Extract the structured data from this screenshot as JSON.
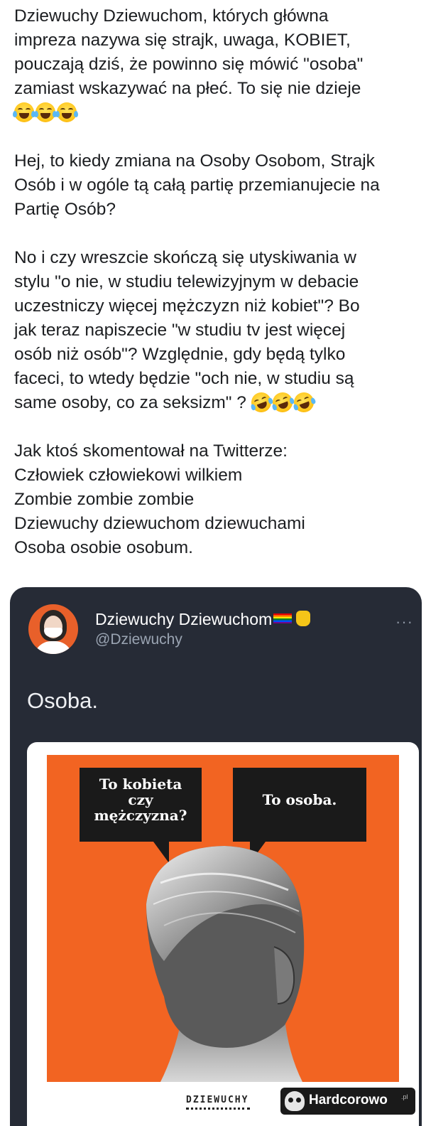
{
  "post": {
    "paragraphs": [
      {
        "lines": [
          "Dziewuchy Dziewuchom, których główna",
          "impreza nazywa się strajk, uwaga, KOBIET,",
          "pouczają dziś, że powinno się mówić \"osoba\"",
          "zamiast wskazywać na płeć. To się nie dzieje"
        ],
        "emoji": "😂😂😂"
      },
      {
        "lines": [
          "Hej, to kiedy zmiana na Osoby Osobom, Strajk",
          "Osób i w ogóle tą całą partię przemianujecie na",
          "Partię Osób?"
        ]
      },
      {
        "lines": [
          "No i czy wreszcie skończą się utyskiwania w",
          "stylu \"o nie, w studiu telewizyjnym w debacie",
          "uczestniczy więcej mężczyzn niż kobiet\"? Bo",
          "jak teraz napiszecie \"w studiu tv jest więcej",
          "osób niż osób\"? Względnie, gdy będą tylko",
          "faceci, to wtedy będzie \"och nie, w studiu są",
          "same osoby, co za seksizm\" ?"
        ],
        "emoji": "🤣🤣🤣"
      },
      {
        "lines": [
          "Jak ktoś skomentował na Twitterze:",
          "Człowiek człowiekowi wilkiem",
          "Zombie zombie zombie",
          "Dziewuchy dziewuchom dziewuchami",
          "Osoba osobie osobum."
        ]
      }
    ]
  },
  "tweet": {
    "author_name": "Dziewuchy Dziewuchom",
    "author_icons": [
      "rainbow-flag-icon",
      "raised-fist-icon"
    ],
    "handle": "@Dziewuchy",
    "more_label": "···",
    "text": "Osoba.",
    "image": {
      "bubble_left": [
        "To kobieta",
        "czy",
        "mężczyzna?"
      ],
      "bubble_right": "To osoba.",
      "brand": "DZIEWUCHY",
      "background_color": "#f26422"
    }
  },
  "watermark": {
    "text": "Hardcorowo",
    "tld": ".pl",
    "icon": "skull-icon"
  },
  "colors": {
    "tweet_bg": "#262b36",
    "text": "#1c1e21"
  }
}
